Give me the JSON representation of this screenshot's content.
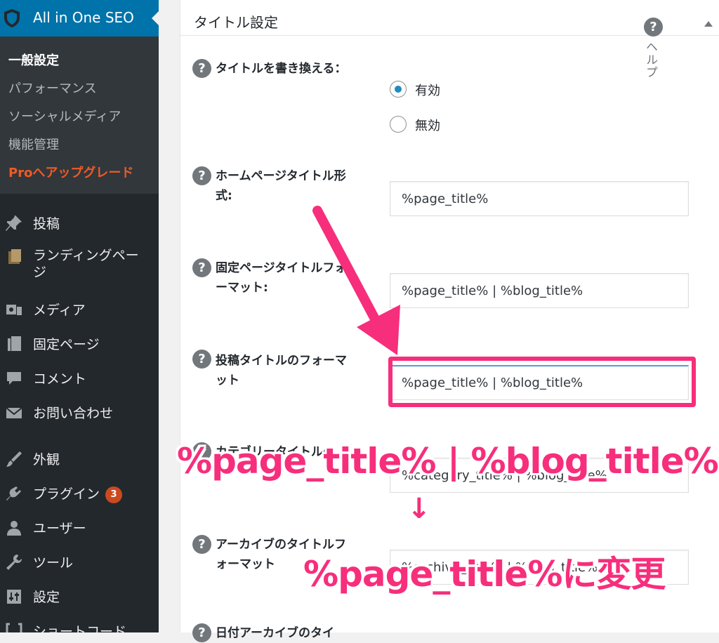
{
  "sidebar": {
    "plugin_title": "All in One SEO",
    "submenu": [
      {
        "label": "一般設定",
        "state": "current"
      },
      {
        "label": "パフォーマンス",
        "state": "normal"
      },
      {
        "label": "ソーシャルメディア",
        "state": "normal"
      },
      {
        "label": "機能管理",
        "state": "normal"
      },
      {
        "label": "Proへアップグレード",
        "state": "pro"
      }
    ],
    "menu": [
      {
        "label": "投稿",
        "icon": "pin-icon"
      },
      {
        "label": "ランディングペー",
        "label2": "ジ",
        "icon": "pages-stack-icon"
      },
      {
        "label": "メディア",
        "icon": "media-icon"
      },
      {
        "label": "固定ページ",
        "icon": "page-icon"
      },
      {
        "label": "コメント",
        "icon": "comment-icon"
      },
      {
        "label": "お問い合わせ",
        "icon": "mail-icon"
      },
      {
        "label": "外観",
        "icon": "brush-icon"
      },
      {
        "label": "プラグイン",
        "icon": "plugin-icon",
        "badge": "3"
      },
      {
        "label": "ユーザー",
        "icon": "user-icon"
      },
      {
        "label": "ツール",
        "icon": "wrench-icon"
      },
      {
        "label": "設定",
        "icon": "settings-icon"
      },
      {
        "label": "ショートコード",
        "icon": "shortcode-icon"
      }
    ],
    "accent_color": "#0073aa",
    "pro_color": "#f15a24"
  },
  "panel": {
    "title": "タイトル設定",
    "help_label": "ヘルプ",
    "help_glyph": "?",
    "rows": [
      {
        "label": "タイトルを書き換える：",
        "options": [
          "有効",
          "無効"
        ],
        "selected": "有効"
      },
      {
        "label": "ホームページタイトル形式:",
        "value": "%page_title%"
      },
      {
        "label": "固定ページタイトルフォーマット:",
        "value": "%page_title% | %blog_title%"
      },
      {
        "label": "投稿タイトルのフォーマット",
        "value": "%page_title% | %blog_title%"
      },
      {
        "label": "カテゴリータイトルの",
        "value": "%category_title% | %blog_title%"
      },
      {
        "label": "アーカイブのタイトルフォーマット",
        "value": "%archive_title% | %blog_title%"
      },
      {
        "label": "日付アーカイブのタイ",
        "value": ""
      }
    ]
  },
  "annotation": {
    "from": "%page_title% | %blog_title%",
    "arrow": "↓",
    "to": "%page_title%に変更",
    "color": "#f72e7c"
  }
}
